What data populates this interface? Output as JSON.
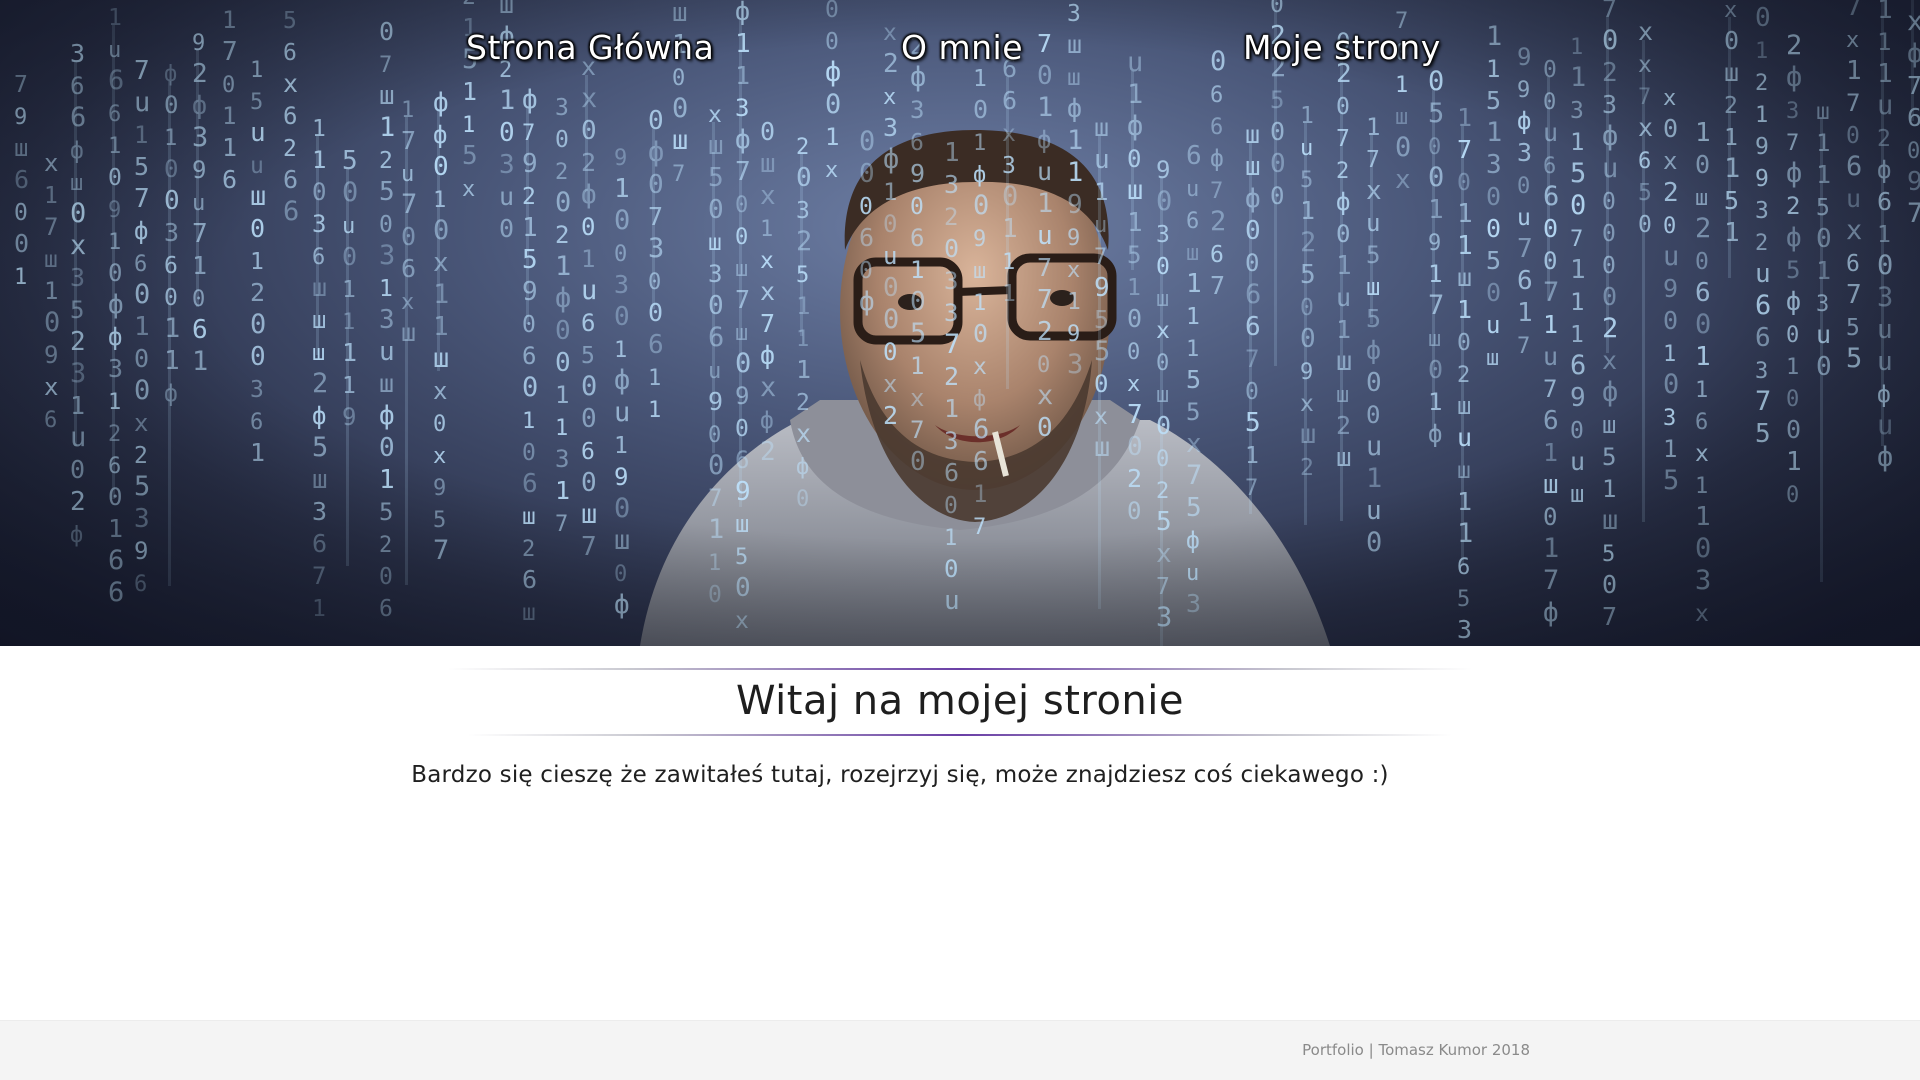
{
  "nav": {
    "home": "Strona Główna",
    "about": "O mnie",
    "projects": "Moje strony"
  },
  "main": {
    "title": "Witaj na mojej stronie",
    "intro": "Bardzo się cieszę że zawitałeś tutaj, rozejrzyj się, może znajdziesz coś ciekawego :)"
  },
  "footer": {
    "text": "Portfolio | Tomasz Kumor 2018"
  },
  "colors": {
    "rule_accent": "#6a3fa6",
    "matrix_glyph": "#bfe4ff",
    "hero_bg": "#4a5779"
  }
}
